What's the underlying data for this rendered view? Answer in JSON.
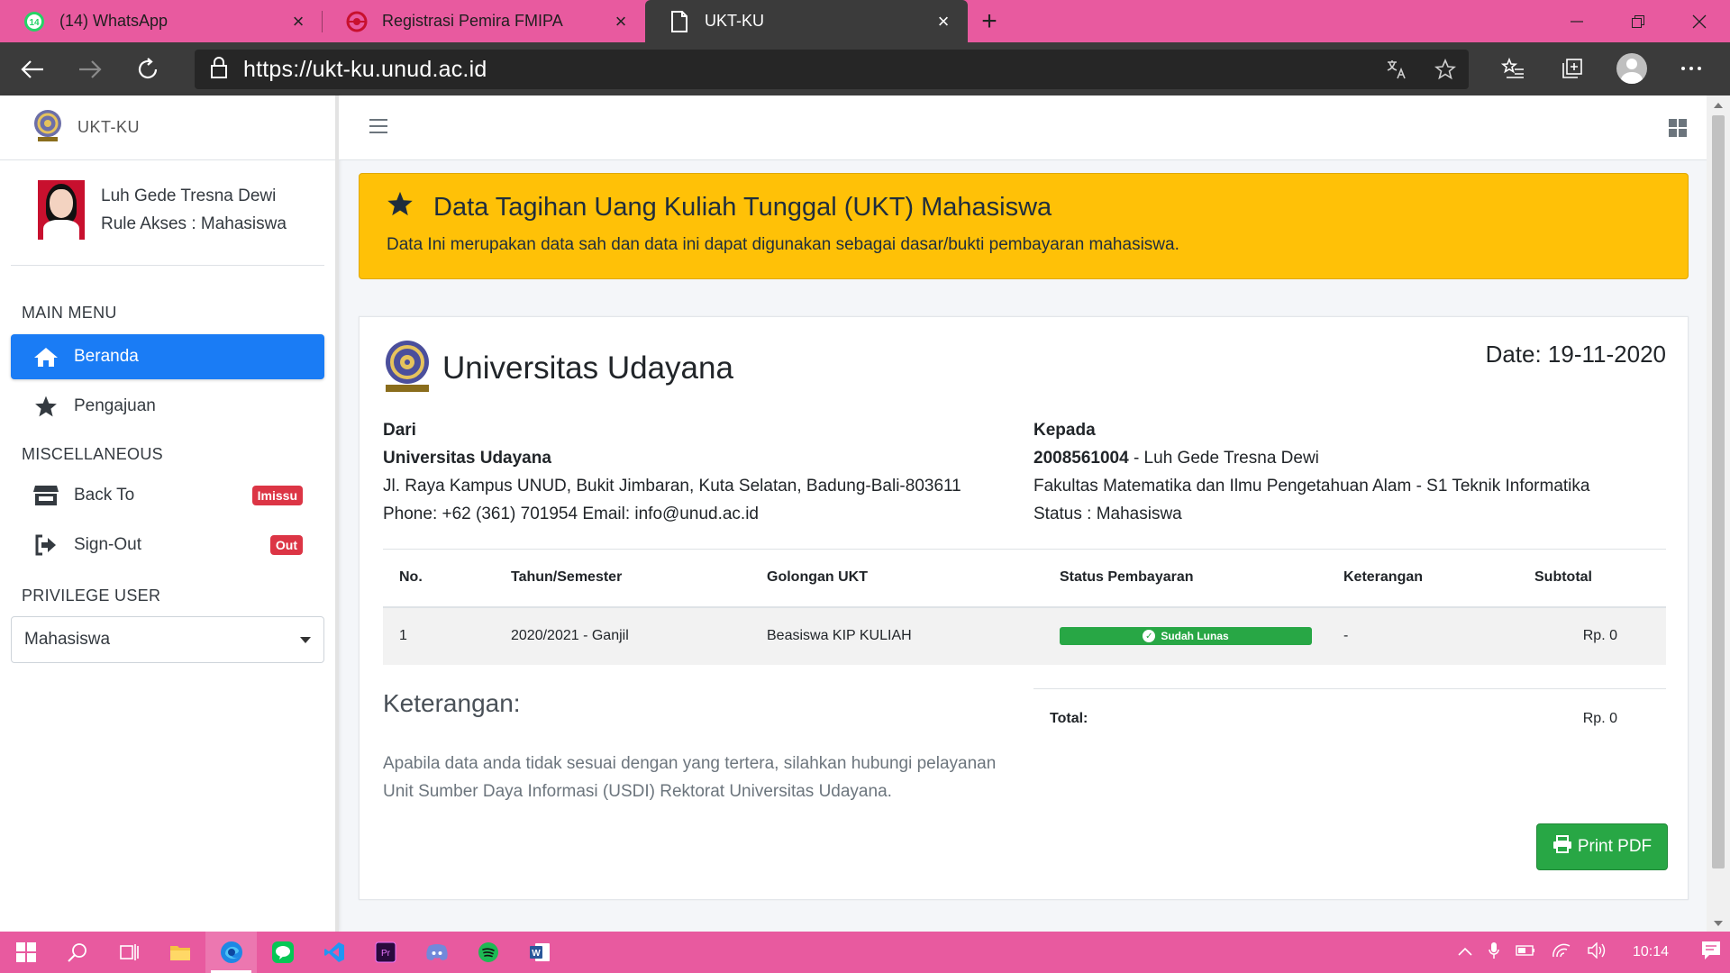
{
  "browser": {
    "tabs": [
      {
        "title": "(14) WhatsApp",
        "badge": "14",
        "icon": "whatsapp-icon"
      },
      {
        "title": "Registrasi Pemira FMIPA",
        "icon": "pemira-icon"
      },
      {
        "title": "UKT-KU",
        "icon": "page-icon"
      }
    ],
    "url": "https://ukt-ku.unud.ac.id"
  },
  "sidebar": {
    "brand": "UKT-KU",
    "user_name": "Luh Gede Tresna Dewi",
    "user_role": "Rule Akses : Mahasiswa",
    "main_menu_header": "MAIN MENU",
    "menu": [
      {
        "label": "Beranda",
        "icon": "home-icon"
      },
      {
        "label": "Pengajuan",
        "icon": "star-icon"
      }
    ],
    "misc_header": "MISCELLANEOUS",
    "misc": [
      {
        "label": "Back To",
        "badge": "Imissu",
        "icon": "store-icon"
      },
      {
        "label": "Sign-Out",
        "badge": "Out",
        "icon": "sign-out-icon"
      }
    ],
    "privilege_header": "PRIVILEGE USER",
    "privilege_value": "Mahasiswa"
  },
  "callout": {
    "title": "Data Tagihan Uang Kuliah Tunggal (UKT) Mahasiswa",
    "text": "Data Ini merupakan data sah dan data ini dapat digunakan sebagai dasar/bukti pembayaran mahasiswa."
  },
  "invoice": {
    "university": "Universitas Udayana",
    "date": "Date: 19-11-2020",
    "from": {
      "label": "Dari",
      "name": "Universitas Udayana",
      "address": "Jl. Raya Kampus UNUD, Bukit Jimbaran, Kuta Selatan, Badung-Bali-803611",
      "contact": "Phone: +62 (361) 701954 Email: info@unud.ac.id"
    },
    "to": {
      "label": "Kepada",
      "nim": "2008561004",
      "name_suffix": " - Luh Gede Tresna Dewi",
      "faculty": "Fakultas Matematika dan Ilmu Pengetahuan Alam - S1 Teknik Informatika",
      "status": "Status : Mahasiswa"
    },
    "table": {
      "headers": [
        "No.",
        "Tahun/Semester",
        "Golongan UKT",
        "Status Pembayaran",
        "Keterangan",
        "Subtotal"
      ],
      "rows": [
        {
          "no": "1",
          "semester": "2020/2021 - Ganjil",
          "golongan": "Beasiswa KIP KULIAH",
          "status": "Sudah Lunas",
          "keterangan": "-",
          "subtotal": "Rp. 0"
        }
      ]
    },
    "keterangan_title": "Keterangan:",
    "keterangan_text": "Apabila data anda tidak sesuai dengan yang tertera, silahkan hubungi pelayanan Unit Sumber Daya Informasi (USDI) Rektorat Universitas Udayana.",
    "total_label": "Total:",
    "total_value": "Rp. 0",
    "print_label": "Print PDF"
  },
  "taskbar": {
    "time": "10:14"
  },
  "colors": {
    "accent_pink": "#e85a9f",
    "active_menu": "#1a7cf5",
    "callout": "#ffc107",
    "success": "#28a745",
    "danger": "#dc3545"
  }
}
